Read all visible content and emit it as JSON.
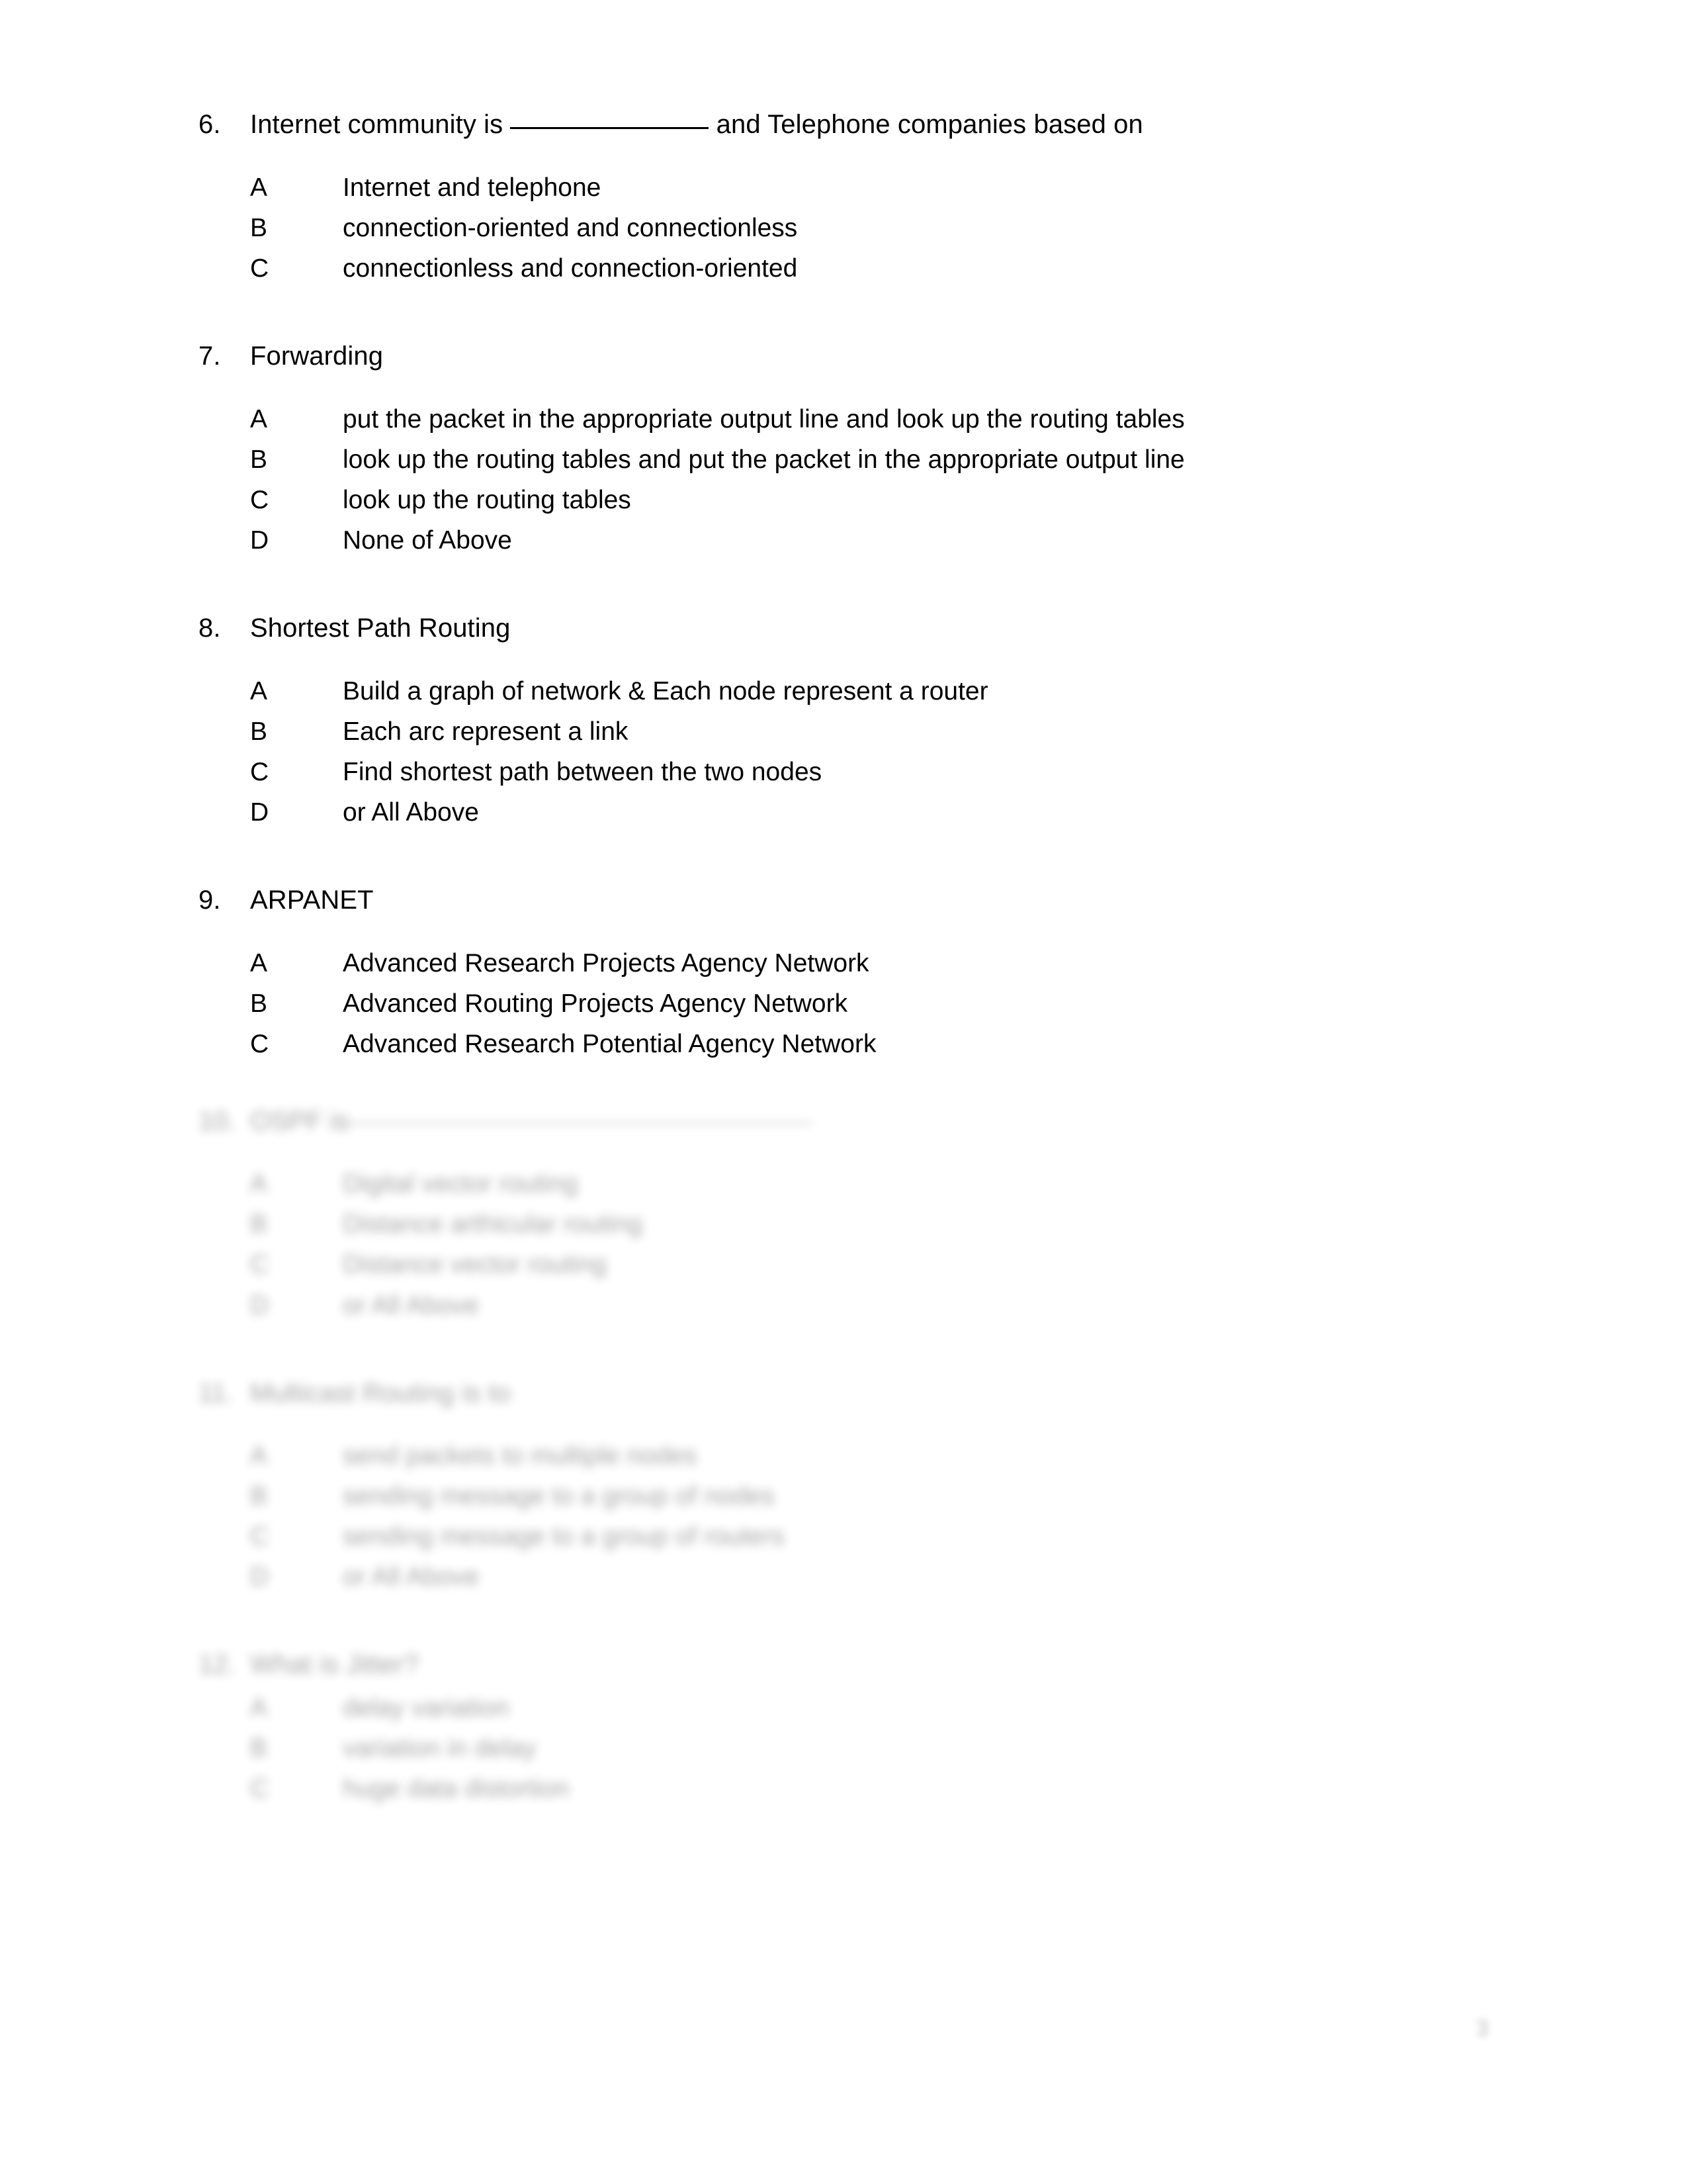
{
  "document": {
    "page_number": "3"
  },
  "questions": [
    {
      "number": "6.",
      "stem_part1": "Internet community is ",
      "stem_part2": " and Telephone companies based on",
      "stem_line2": "",
      "has_blank_inline": true,
      "has_blank_line2": true,
      "blurred": false,
      "options": [
        {
          "letter": "A",
          "text": "Internet and telephone"
        },
        {
          "letter": "B",
          "text": "connection-oriented and connectionless"
        },
        {
          "letter": "C",
          "text": "connectionless and connection-oriented"
        }
      ]
    },
    {
      "number": "7.",
      "stem_part1": "Forwarding",
      "stem_part2": "",
      "has_blank_inline": false,
      "blurred": false,
      "options": [
        {
          "letter": "A",
          "text": "put the packet in the appropriate output line and look up the routing tables"
        },
        {
          "letter": "B",
          "text": "look up the routing tables and put the packet in the appropriate output line"
        },
        {
          "letter": "C",
          "text": "look up the routing tables"
        },
        {
          "letter": "D",
          "text": "None of Above"
        }
      ]
    },
    {
      "number": "8.",
      "stem_part1": "Shortest Path Routing",
      "stem_part2": "",
      "has_blank_inline": false,
      "blurred": false,
      "options": [
        {
          "letter": "A",
          "text": "Build a graph of network & Each node represent a router"
        },
        {
          "letter": "B",
          "text": "Each arc represent a link"
        },
        {
          "letter": "C",
          "text": "Find shortest path between the two nodes"
        },
        {
          "letter": "D",
          "text": "or All Above"
        }
      ]
    },
    {
      "number": "9.",
      "stem_part1": "ARPANET",
      "stem_part2": "",
      "has_blank_inline": false,
      "blurred": false,
      "options": [
        {
          "letter": "A",
          "text": "Advanced Research Projects Agency Network"
        },
        {
          "letter": "B",
          "text": "Advanced Routing Projects Agency Network"
        },
        {
          "letter": "C",
          "text": "Advanced Research Potential Agency Network"
        }
      ]
    },
    {
      "number": "10.",
      "stem_part1": "OSPF is",
      "stem_part2": "",
      "has_blank_inline": true,
      "blurred": true,
      "options": [
        {
          "letter": "A",
          "text": "Digital vector routing"
        },
        {
          "letter": "B",
          "text": "Distance arthicular routing"
        },
        {
          "letter": "C",
          "text": "Distance vector routing"
        },
        {
          "letter": "D",
          "text": "or All Above"
        }
      ]
    },
    {
      "number": "11.",
      "stem_part1": "Multicast Routing is to",
      "stem_part2": "",
      "has_blank_inline": false,
      "blurred": true,
      "options": [
        {
          "letter": "A",
          "text": "send packets to multiple nodes"
        },
        {
          "letter": "B",
          "text": "sending message to a group of nodes"
        },
        {
          "letter": "C",
          "text": "sending message to a group of routers"
        },
        {
          "letter": "D",
          "text": "or All Above"
        }
      ]
    },
    {
      "number": "12.",
      "stem_part1": "What is Jitter?",
      "stem_part2": "",
      "has_blank_inline": false,
      "blurred": true,
      "tight_options": true,
      "options": [
        {
          "letter": "A",
          "text": "delay variation"
        },
        {
          "letter": "B",
          "text": "variation in delay"
        },
        {
          "letter": "C",
          "text": "huge data distortion"
        }
      ]
    }
  ]
}
